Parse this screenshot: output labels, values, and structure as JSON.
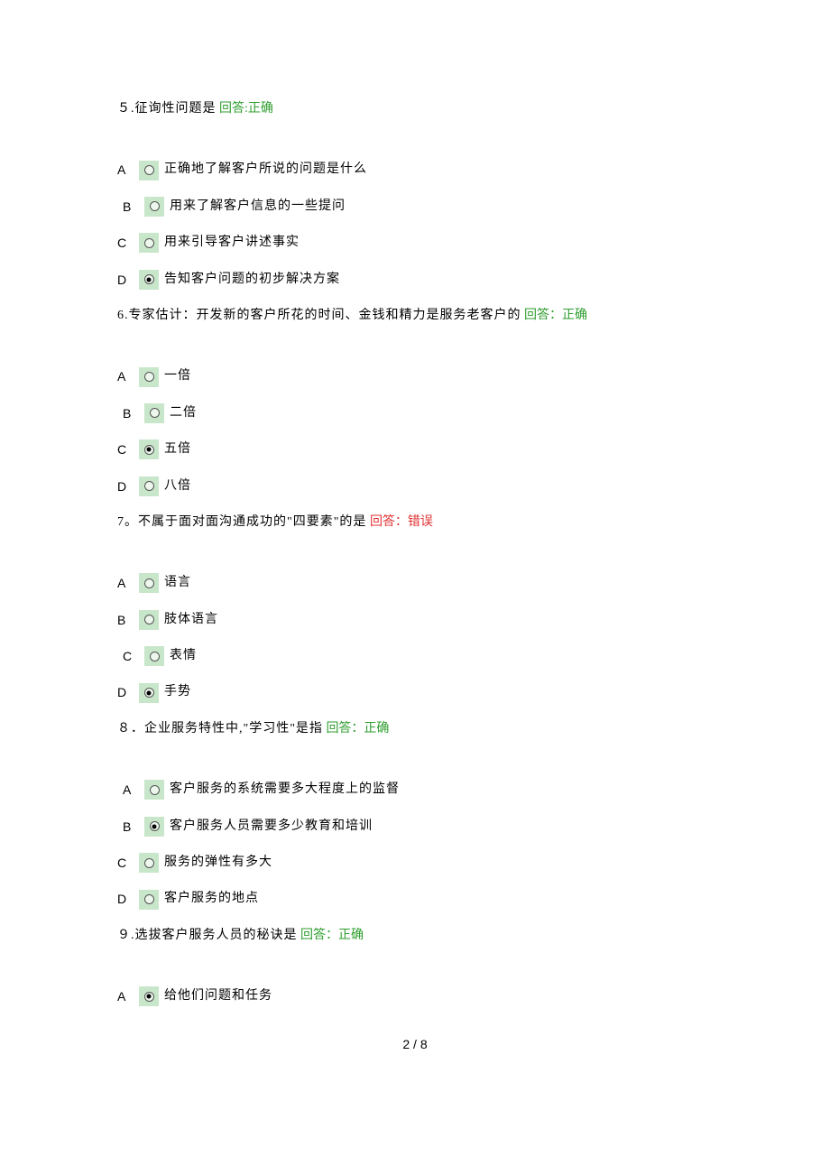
{
  "questions": [
    {
      "number": "５.",
      "text": "征询性问题是",
      "answer_label": "回答:正确",
      "answer_status": "correct",
      "options": [
        {
          "letter": "A",
          "text": "正确地了解客户所说的问题是什么",
          "selected": false,
          "indent": false
        },
        {
          "letter": "B",
          "text": "用来了解客户信息的一些提问",
          "selected": false,
          "indent": true
        },
        {
          "letter": "C",
          "text": "用来引导客户讲述事实",
          "selected": false,
          "indent": false
        },
        {
          "letter": "D",
          "text": "告知客户问题的初步解决方案",
          "selected": true,
          "indent": false
        }
      ]
    },
    {
      "number": "6.",
      "text": "专家估计：开发新的客户所花的时间、金钱和精力是服务老客户的",
      "answer_label": "回答：正确",
      "answer_status": "correct",
      "options": [
        {
          "letter": "A",
          "text": "一倍",
          "selected": false,
          "indent": false
        },
        {
          "letter": "B",
          "text": "二倍",
          "selected": false,
          "indent": true
        },
        {
          "letter": "C",
          "text": "五倍",
          "selected": true,
          "indent": false
        },
        {
          "letter": "D",
          "text": "八倍",
          "selected": false,
          "indent": false
        }
      ]
    },
    {
      "number": "7。",
      "text": "不属于面对面沟通成功的\"四要素\"的是",
      "answer_label": "回答：错误",
      "answer_status": "wrong",
      "options": [
        {
          "letter": "A",
          "text": "语言",
          "selected": false,
          "indent": false
        },
        {
          "letter": "B",
          "text": "肢体语言",
          "selected": false,
          "indent": false
        },
        {
          "letter": "C",
          "text": "表情",
          "selected": false,
          "indent": true
        },
        {
          "letter": "D",
          "text": "手势",
          "selected": true,
          "indent": false
        }
      ]
    },
    {
      "number": "８．",
      "text": "企业服务特性中,\"学习性\"是指",
      "answer_label": "回答：正确",
      "answer_status": "correct",
      "options": [
        {
          "letter": "A",
          "text": "客户服务的系统需要多大程度上的监督",
          "selected": false,
          "indent": true
        },
        {
          "letter": "B",
          "text": "客户服务人员需要多少教育和培训",
          "selected": true,
          "indent": true
        },
        {
          "letter": "C",
          "text": "服务的弹性有多大",
          "selected": false,
          "indent": false
        },
        {
          "letter": "D",
          "text": "客户服务的地点",
          "selected": false,
          "indent": false
        }
      ]
    },
    {
      "number": "９.",
      "text": "选拔客户服务人员的秘诀是",
      "answer_label": "回答：正确",
      "answer_status": "correct",
      "options": [
        {
          "letter": "A",
          "text": "给他们问题和任务",
          "selected": true,
          "indent": false
        }
      ]
    }
  ],
  "footer": "2 / 8"
}
